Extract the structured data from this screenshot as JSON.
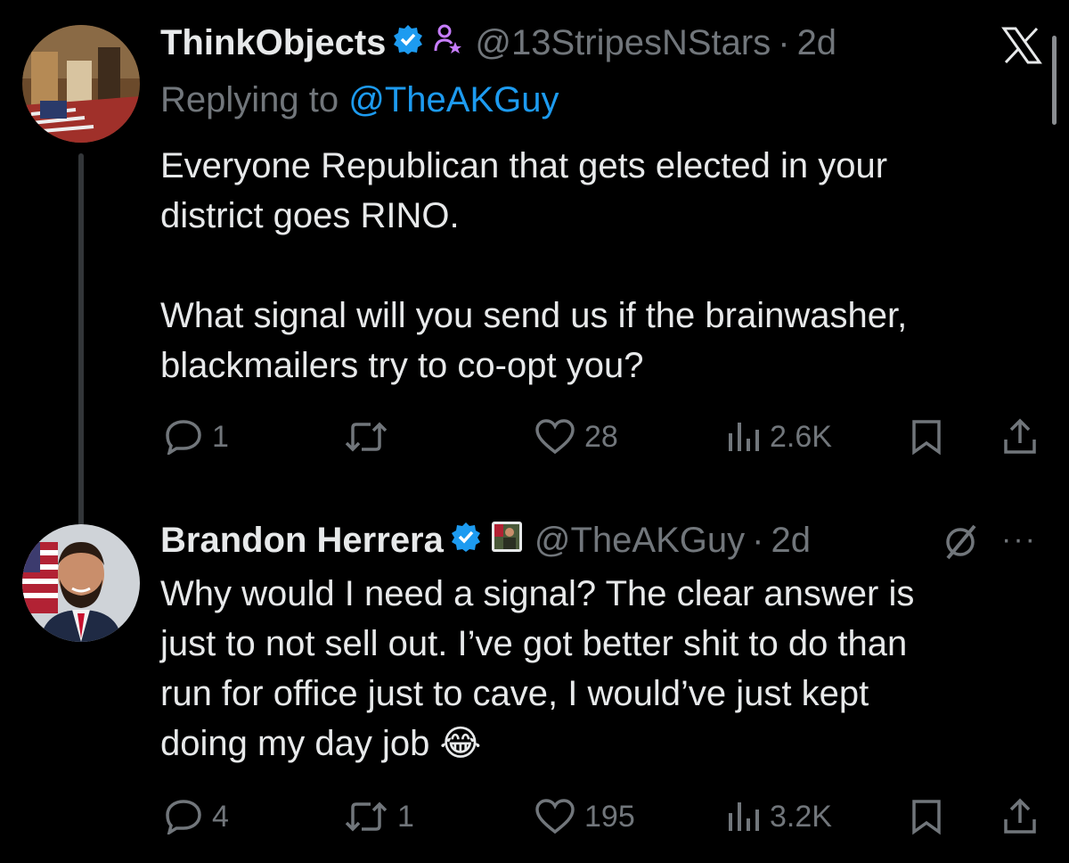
{
  "tweets": [
    {
      "name": "ThinkObjects",
      "handle": "@13StripesNStars",
      "separator": "·",
      "time": "2d",
      "replying_prefix": "Replying to ",
      "replying_to": "@TheAKGuy",
      "text": "Everyone Republican that gets elected in your\ndistrict goes RINO.\n\nWhat signal will you send us if the brainwasher,\nblackmailers try to co-opt you?",
      "replies": "1",
      "retweets": "",
      "likes": "28",
      "views": "2.6K",
      "verified_color": "#1d9bf0",
      "affiliate_icon": "person-star-icon"
    },
    {
      "name": "Brandon Herrera",
      "handle": "@TheAKGuy",
      "separator": "·",
      "time": "2d",
      "text": "Why would I need a signal? The clear answer is\njust to not sell out. I’ve got better shit to do than\nrun for office just to cave, I would’ve just kept\ndoing my day job ",
      "emoji": "😂",
      "replies": "4",
      "retweets": "1",
      "likes": "195",
      "views": "3.2K",
      "verified_color": "#1d9bf0",
      "more_label": "···"
    }
  ],
  "colors": {
    "background": "#000000",
    "text": "#e7e9ea",
    "muted": "#71767b",
    "accent": "#1d9bf0"
  }
}
